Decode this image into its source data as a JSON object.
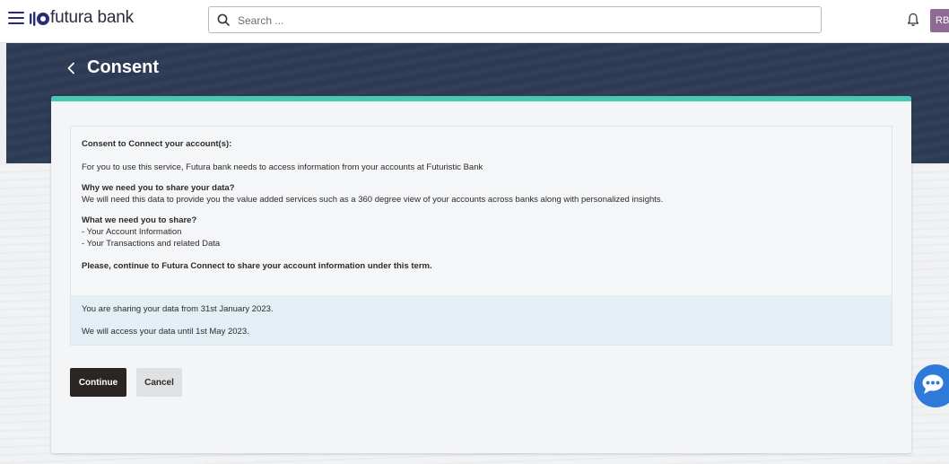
{
  "header": {
    "brand_name": "futura bank",
    "search_placeholder": "Search ...",
    "avatar_initials": "RB",
    "avatar_color": "#8f6a95"
  },
  "page": {
    "title": "Consent"
  },
  "consent": {
    "heading": "Consent to Connect your account(s):",
    "intro": "For you to use this service, Futura bank needs to access information from your accounts at Futuristic Bank",
    "why_heading": "Why we need you to share your data?",
    "why_text": "We will need this data to provide you the value added services such as a 360 degree view of your accounts across banks along with personalized insights.",
    "what_heading": "What we need you to share?",
    "share_items": [
      "- Your Account Information",
      "- Your Transactions and related Data"
    ],
    "closing": "Please, continue to Futura Connect to share your account information under this term.",
    "sharing_from": "You are sharing your data from 31st January 2023.",
    "access_until": "We will access your data until 1st May 2023."
  },
  "actions": {
    "continue_label": "Continue",
    "cancel_label": "Cancel"
  },
  "icons": {
    "menu": "hamburger-menu-icon",
    "search": "search-icon",
    "notifications": "bell-icon",
    "back": "chevron-left-icon",
    "chat": "chat-bubble-icon"
  },
  "colors": {
    "accent": "#49c7b1",
    "banner": "#2d3b55",
    "primary_button": "#2b2623",
    "chat": "#2e7ad9"
  }
}
